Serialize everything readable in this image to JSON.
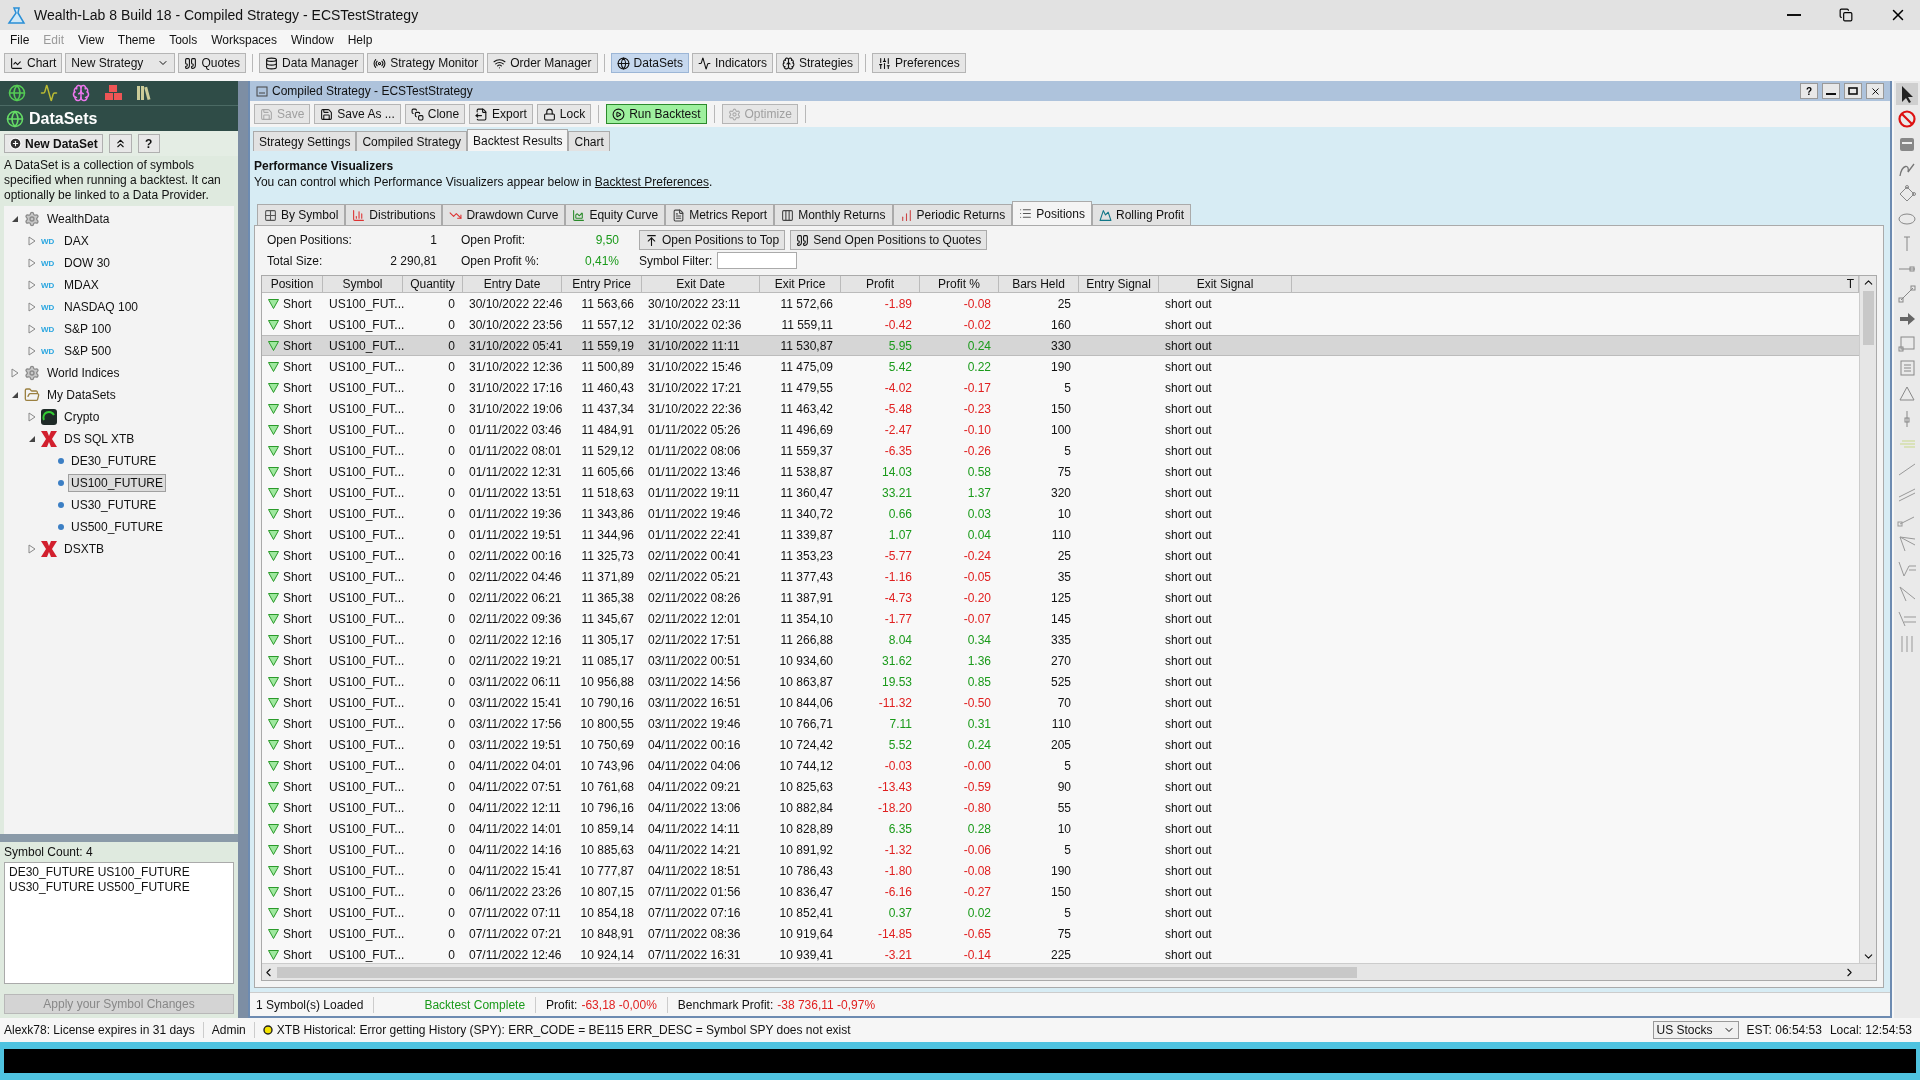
{
  "window": {
    "title": "Wealth-Lab 8 Build 18 - Compiled Strategy - ECSTestStrategy"
  },
  "menu": [
    {
      "label": "File",
      "disabled": false
    },
    {
      "label": "Edit",
      "disabled": true
    },
    {
      "label": "View",
      "disabled": false
    },
    {
      "label": "Theme",
      "disabled": false
    },
    {
      "label": "Tools",
      "disabled": false
    },
    {
      "label": "Workspaces",
      "disabled": false
    },
    {
      "label": "Window",
      "disabled": false
    },
    {
      "label": "Help",
      "disabled": false
    }
  ],
  "toolbar_groups": [
    [
      {
        "label": "Chart",
        "kind": "button",
        "selected": false
      },
      {
        "label": "New Strategy",
        "kind": "dropdown",
        "selected": false
      },
      {
        "label": "Quotes",
        "kind": "button",
        "selected": false
      }
    ],
    [
      {
        "label": "Data Manager",
        "kind": "button",
        "selected": false
      },
      {
        "label": "Strategy Monitor",
        "kind": "button",
        "selected": false
      },
      {
        "label": "Order Manager",
        "kind": "button",
        "selected": false
      }
    ],
    [
      {
        "label": "DataSets",
        "kind": "button",
        "selected": true
      },
      {
        "label": "Indicators",
        "kind": "button",
        "selected": false
      },
      {
        "label": "Strategies",
        "kind": "button",
        "selected": false
      }
    ],
    [
      {
        "label": "Preferences",
        "kind": "button",
        "selected": false
      }
    ]
  ],
  "sidebar": {
    "title": "DataSets",
    "buttons": [
      {
        "kind": "new",
        "label": "New DataSet"
      },
      {
        "kind": "collapse"
      },
      {
        "kind": "help",
        "label": "?"
      }
    ],
    "description": "A DataSet is a collection of symbols specified when running a backtest. It can optionally be linked to a Data Provider.",
    "tree": [
      {
        "label": "WealthData",
        "kind": "gear",
        "expanded": true,
        "selected": false,
        "children": [
          {
            "label": "DAX",
            "kind": "wd",
            "badge": "WD",
            "expanded": false,
            "selected": false
          },
          {
            "label": "DOW 30",
            "kind": "wd",
            "badge": "WD",
            "expanded": false,
            "selected": false
          },
          {
            "label": "MDAX",
            "kind": "wd",
            "badge": "WD",
            "expanded": false,
            "selected": false
          },
          {
            "label": "NASDAQ 100",
            "kind": "wd",
            "badge": "WD",
            "expanded": false,
            "selected": false
          },
          {
            "label": "S&P 100",
            "kind": "wd",
            "badge": "WD",
            "expanded": false,
            "selected": false
          },
          {
            "label": "S&P 500",
            "kind": "wd",
            "badge": "WD",
            "expanded": false,
            "selected": false
          }
        ]
      },
      {
        "label": "World Indices",
        "kind": "gear",
        "expanded": false,
        "selected": false
      },
      {
        "label": "My DataSets",
        "kind": "folder",
        "expanded": true,
        "selected": false,
        "children": [
          {
            "label": "Crypto",
            "kind": "crypto",
            "expanded": false,
            "selected": false
          },
          {
            "label": "DS SQL XTB",
            "kind": "xtb",
            "expanded": true,
            "selected": false,
            "children": [
              {
                "label": "DE30_FUTURE",
                "kind": "dot",
                "selected": false
              },
              {
                "label": "US100_FUTURE",
                "kind": "dot",
                "selected": true
              },
              {
                "label": "US30_FUTURE",
                "kind": "dot",
                "selected": false
              },
              {
                "label": "US500_FUTURE",
                "kind": "dot",
                "selected": false
              }
            ]
          },
          {
            "label": "DSXTB",
            "kind": "xtb",
            "expanded": false,
            "selected": false
          }
        ]
      }
    ],
    "symbol_count": "Symbol Count: 4",
    "symbols": [
      "DE30_FUTURE US100_FUTURE",
      "US30_FUTURE US500_FUTURE"
    ],
    "apply_button": {
      "label": "Apply your Symbol Changes",
      "disabled": true
    }
  },
  "document": {
    "title": "Compiled Strategy - ECSTestStrategy",
    "help": "?",
    "toolbar": [
      {
        "label": "Save",
        "disabled": true,
        "highlighted": false
      },
      {
        "label": "Save As ...",
        "disabled": false,
        "highlighted": false
      },
      {
        "label": "Clone",
        "disabled": false,
        "highlighted": false
      },
      {
        "label": "Export",
        "disabled": false,
        "highlighted": false
      },
      {
        "label": "Lock",
        "disabled": false,
        "highlighted": false
      },
      {
        "label": "Run Backtest",
        "disabled": false,
        "highlighted": true
      },
      {
        "label": "Optimize",
        "disabled": true,
        "highlighted": false
      }
    ],
    "tabs": [
      {
        "label": "Strategy Settings",
        "selected": false
      },
      {
        "label": "Compiled Strategy",
        "selected": false
      },
      {
        "label": "Backtest Results",
        "selected": true
      },
      {
        "label": "Chart",
        "selected": false
      }
    ],
    "heading": "Performance Visualizers",
    "note": "You can control which Performance Visualizers appear below in ",
    "link": "Backtest Preferences",
    "note_end": ".",
    "visualizer_tabs": [
      {
        "label": "By Symbol",
        "selected": false
      },
      {
        "label": "Distributions",
        "selected": false
      },
      {
        "label": "Drawdown Curve",
        "selected": false
      },
      {
        "label": "Equity Curve",
        "selected": false
      },
      {
        "label": "Metrics Report",
        "selected": false
      },
      {
        "label": "Monthly Returns",
        "selected": false
      },
      {
        "label": "Periodic Returns",
        "selected": false
      },
      {
        "label": "Positions",
        "selected": true
      },
      {
        "label": "Rolling Profit",
        "selected": false
      }
    ],
    "stats": [
      {
        "label": "Open Positions:",
        "value": "1",
        "gain": false
      },
      {
        "label": "Open Profit:",
        "value": "9,50",
        "gain": true
      },
      {
        "label": "Total Size:",
        "value": "2 290,81",
        "gain": false
      },
      {
        "label": "Open Profit %:",
        "value": "0,41%",
        "gain": true
      }
    ],
    "position_buttons": [
      "Open Positions to Top",
      "Send Open Positions to Quotes"
    ],
    "symbol_filter": {
      "label": "Symbol Filter:"
    },
    "table": {
      "columns": [
        "Position",
        "Symbol",
        "Quantity",
        "Entry Date",
        "Entry Price",
        "Exit Date",
        "Exit Price",
        "Profit",
        "Profit %",
        "Bars Held",
        "Entry Signal",
        "Exit Signal",
        "T"
      ],
      "rows": [
        {
          "position": "Short",
          "symbol": "US100_FUT...",
          "quantity": "0",
          "entry_date": "30/10/2022 22:46",
          "entry_price": "11 563,66",
          "exit_date": "30/10/2022 23:11",
          "exit_price": "11 572,66",
          "profit": "-1.89",
          "profit_pct": "-0.08",
          "bars_held": "25",
          "exit_signal": "short out",
          "gain": false,
          "selected": false
        },
        {
          "position": "Short",
          "symbol": "US100_FUT...",
          "quantity": "0",
          "entry_date": "30/10/2022 23:56",
          "entry_price": "11 557,12",
          "exit_date": "31/10/2022 02:36",
          "exit_price": "11 559,11",
          "profit": "-0.42",
          "profit_pct": "-0.02",
          "bars_held": "160",
          "exit_signal": "short out",
          "gain": false,
          "selected": false
        },
        {
          "position": "Short",
          "symbol": "US100_FUT...",
          "quantity": "0",
          "entry_date": "31/10/2022 05:41",
          "entry_price": "11 559,19",
          "exit_date": "31/10/2022 11:11",
          "exit_price": "11 530,87",
          "profit": "5.95",
          "profit_pct": "0.24",
          "bars_held": "330",
          "exit_signal": "short out",
          "gain": true,
          "selected": true
        },
        {
          "position": "Short",
          "symbol": "US100_FUT...",
          "quantity": "0",
          "entry_date": "31/10/2022 12:36",
          "entry_price": "11 500,89",
          "exit_date": "31/10/2022 15:46",
          "exit_price": "11 475,09",
          "profit": "5.42",
          "profit_pct": "0.22",
          "bars_held": "190",
          "exit_signal": "short out",
          "gain": true,
          "selected": false
        },
        {
          "position": "Short",
          "symbol": "US100_FUT...",
          "quantity": "0",
          "entry_date": "31/10/2022 17:16",
          "entry_price": "11 460,43",
          "exit_date": "31/10/2022 17:21",
          "exit_price": "11 479,55",
          "profit": "-4.02",
          "profit_pct": "-0.17",
          "bars_held": "5",
          "exit_signal": "short out",
          "gain": false,
          "selected": false
        },
        {
          "position": "Short",
          "symbol": "US100_FUT...",
          "quantity": "0",
          "entry_date": "31/10/2022 19:06",
          "entry_price": "11 437,34",
          "exit_date": "31/10/2022 22:36",
          "exit_price": "11 463,42",
          "profit": "-5.48",
          "profit_pct": "-0.23",
          "bars_held": "150",
          "exit_signal": "short out",
          "gain": false,
          "selected": false
        },
        {
          "position": "Short",
          "symbol": "US100_FUT...",
          "quantity": "0",
          "entry_date": "01/11/2022 03:46",
          "entry_price": "11 484,91",
          "exit_date": "01/11/2022 05:26",
          "exit_price": "11 496,69",
          "profit": "-2.47",
          "profit_pct": "-0.10",
          "bars_held": "100",
          "exit_signal": "short out",
          "gain": false,
          "selected": false
        },
        {
          "position": "Short",
          "symbol": "US100_FUT...",
          "quantity": "0",
          "entry_date": "01/11/2022 08:01",
          "entry_price": "11 529,12",
          "exit_date": "01/11/2022 08:06",
          "exit_price": "11 559,37",
          "profit": "-6.35",
          "profit_pct": "-0.26",
          "bars_held": "5",
          "exit_signal": "short out",
          "gain": false,
          "selected": false
        },
        {
          "position": "Short",
          "symbol": "US100_FUT...",
          "quantity": "0",
          "entry_date": "01/11/2022 12:31",
          "entry_price": "11 605,66",
          "exit_date": "01/11/2022 13:46",
          "exit_price": "11 538,87",
          "profit": "14.03",
          "profit_pct": "0.58",
          "bars_held": "75",
          "exit_signal": "short out",
          "gain": true,
          "selected": false
        },
        {
          "position": "Short",
          "symbol": "US100_FUT...",
          "quantity": "0",
          "entry_date": "01/11/2022 13:51",
          "entry_price": "11 518,63",
          "exit_date": "01/11/2022 19:11",
          "exit_price": "11 360,47",
          "profit": "33.21",
          "profit_pct": "1.37",
          "bars_held": "320",
          "exit_signal": "short out",
          "gain": true,
          "selected": false
        },
        {
          "position": "Short",
          "symbol": "US100_FUT...",
          "quantity": "0",
          "entry_date": "01/11/2022 19:36",
          "entry_price": "11 343,86",
          "exit_date": "01/11/2022 19:46",
          "exit_price": "11 340,72",
          "profit": "0.66",
          "profit_pct": "0.03",
          "bars_held": "10",
          "exit_signal": "short out",
          "gain": true,
          "selected": false
        },
        {
          "position": "Short",
          "symbol": "US100_FUT...",
          "quantity": "0",
          "entry_date": "01/11/2022 19:51",
          "entry_price": "11 344,96",
          "exit_date": "01/11/2022 22:41",
          "exit_price": "11 339,87",
          "profit": "1.07",
          "profit_pct": "0.04",
          "bars_held": "110",
          "exit_signal": "short out",
          "gain": true,
          "selected": false
        },
        {
          "position": "Short",
          "symbol": "US100_FUT...",
          "quantity": "0",
          "entry_date": "02/11/2022 00:16",
          "entry_price": "11 325,73",
          "exit_date": "02/11/2022 00:41",
          "exit_price": "11 353,23",
          "profit": "-5.77",
          "profit_pct": "-0.24",
          "bars_held": "25",
          "exit_signal": "short out",
          "gain": false,
          "selected": false
        },
        {
          "position": "Short",
          "symbol": "US100_FUT...",
          "quantity": "0",
          "entry_date": "02/11/2022 04:46",
          "entry_price": "11 371,89",
          "exit_date": "02/11/2022 05:21",
          "exit_price": "11 377,43",
          "profit": "-1.16",
          "profit_pct": "-0.05",
          "bars_held": "35",
          "exit_signal": "short out",
          "gain": false,
          "selected": false
        },
        {
          "position": "Short",
          "symbol": "US100_FUT...",
          "quantity": "0",
          "entry_date": "02/11/2022 06:21",
          "entry_price": "11 365,38",
          "exit_date": "02/11/2022 08:26",
          "exit_price": "11 387,91",
          "profit": "-4.73",
          "profit_pct": "-0.20",
          "bars_held": "125",
          "exit_signal": "short out",
          "gain": false,
          "selected": false
        },
        {
          "position": "Short",
          "symbol": "US100_FUT...",
          "quantity": "0",
          "entry_date": "02/11/2022 09:36",
          "entry_price": "11 345,67",
          "exit_date": "02/11/2022 12:01",
          "exit_price": "11 354,10",
          "profit": "-1.77",
          "profit_pct": "-0.07",
          "bars_held": "145",
          "exit_signal": "short out",
          "gain": false,
          "selected": false
        },
        {
          "position": "Short",
          "symbol": "US100_FUT...",
          "quantity": "0",
          "entry_date": "02/11/2022 12:16",
          "entry_price": "11 305,17",
          "exit_date": "02/11/2022 17:51",
          "exit_price": "11 266,88",
          "profit": "8.04",
          "profit_pct": "0.34",
          "bars_held": "335",
          "exit_signal": "short out",
          "gain": true,
          "selected": false
        },
        {
          "position": "Short",
          "symbol": "US100_FUT...",
          "quantity": "0",
          "entry_date": "02/11/2022 19:21",
          "entry_price": "11 085,17",
          "exit_date": "03/11/2022 00:51",
          "exit_price": "10 934,60",
          "profit": "31.62",
          "profit_pct": "1.36",
          "bars_held": "270",
          "exit_signal": "short out",
          "gain": true,
          "selected": false
        },
        {
          "position": "Short",
          "symbol": "US100_FUT...",
          "quantity": "0",
          "entry_date": "03/11/2022 06:11",
          "entry_price": "10 956,88",
          "exit_date": "03/11/2022 14:56",
          "exit_price": "10 863,87",
          "profit": "19.53",
          "profit_pct": "0.85",
          "bars_held": "525",
          "exit_signal": "short out",
          "gain": true,
          "selected": false
        },
        {
          "position": "Short",
          "symbol": "US100_FUT...",
          "quantity": "0",
          "entry_date": "03/11/2022 15:41",
          "entry_price": "10 790,16",
          "exit_date": "03/11/2022 16:51",
          "exit_price": "10 844,06",
          "profit": "-11.32",
          "profit_pct": "-0.50",
          "bars_held": "70",
          "exit_signal": "short out",
          "gain": false,
          "selected": false
        },
        {
          "position": "Short",
          "symbol": "US100_FUT...",
          "quantity": "0",
          "entry_date": "03/11/2022 17:56",
          "entry_price": "10 800,55",
          "exit_date": "03/11/2022 19:46",
          "exit_price": "10 766,71",
          "profit": "7.11",
          "profit_pct": "0.31",
          "bars_held": "110",
          "exit_signal": "short out",
          "gain": true,
          "selected": false
        },
        {
          "position": "Short",
          "symbol": "US100_FUT...",
          "quantity": "0",
          "entry_date": "03/11/2022 19:51",
          "entry_price": "10 750,69",
          "exit_date": "04/11/2022 00:16",
          "exit_price": "10 724,42",
          "profit": "5.52",
          "profit_pct": "0.24",
          "bars_held": "205",
          "exit_signal": "short out",
          "gain": true,
          "selected": false
        },
        {
          "position": "Short",
          "symbol": "US100_FUT...",
          "quantity": "0",
          "entry_date": "04/11/2022 04:01",
          "entry_price": "10 743,96",
          "exit_date": "04/11/2022 04:06",
          "exit_price": "10 744,12",
          "profit": "-0.03",
          "profit_pct": "-0.00",
          "bars_held": "5",
          "exit_signal": "short out",
          "gain": false,
          "selected": false
        },
        {
          "position": "Short",
          "symbol": "US100_FUT...",
          "quantity": "0",
          "entry_date": "04/11/2022 07:51",
          "entry_price": "10 761,68",
          "exit_date": "04/11/2022 09:21",
          "exit_price": "10 825,63",
          "profit": "-13.43",
          "profit_pct": "-0.59",
          "bars_held": "90",
          "exit_signal": "short out",
          "gain": false,
          "selected": false
        },
        {
          "position": "Short",
          "symbol": "US100_FUT...",
          "quantity": "0",
          "entry_date": "04/11/2022 12:11",
          "entry_price": "10 796,16",
          "exit_date": "04/11/2022 13:06",
          "exit_price": "10 882,84",
          "profit": "-18.20",
          "profit_pct": "-0.80",
          "bars_held": "55",
          "exit_signal": "short out",
          "gain": false,
          "selected": false
        },
        {
          "position": "Short",
          "symbol": "US100_FUT...",
          "quantity": "0",
          "entry_date": "04/11/2022 14:01",
          "entry_price": "10 859,14",
          "exit_date": "04/11/2022 14:11",
          "exit_price": "10 828,89",
          "profit": "6.35",
          "profit_pct": "0.28",
          "bars_held": "10",
          "exit_signal": "short out",
          "gain": true,
          "selected": false
        },
        {
          "position": "Short",
          "symbol": "US100_FUT...",
          "quantity": "0",
          "entry_date": "04/11/2022 14:16",
          "entry_price": "10 885,63",
          "exit_date": "04/11/2022 14:21",
          "exit_price": "10 891,92",
          "profit": "-1.32",
          "profit_pct": "-0.06",
          "bars_held": "5",
          "exit_signal": "short out",
          "gain": false,
          "selected": false
        },
        {
          "position": "Short",
          "symbol": "US100_FUT...",
          "quantity": "0",
          "entry_date": "04/11/2022 15:41",
          "entry_price": "10 777,87",
          "exit_date": "04/11/2022 18:51",
          "exit_price": "10 786,43",
          "profit": "-1.80",
          "profit_pct": "-0.08",
          "bars_held": "190",
          "exit_signal": "short out",
          "gain": false,
          "selected": false
        },
        {
          "position": "Short",
          "symbol": "US100_FUT...",
          "quantity": "0",
          "entry_date": "06/11/2022 23:26",
          "entry_price": "10 807,15",
          "exit_date": "07/11/2022 01:56",
          "exit_price": "10 836,47",
          "profit": "-6.16",
          "profit_pct": "-0.27",
          "bars_held": "150",
          "exit_signal": "short out",
          "gain": false,
          "selected": false
        },
        {
          "position": "Short",
          "symbol": "US100_FUT...",
          "quantity": "0",
          "entry_date": "07/11/2022 07:11",
          "entry_price": "10 854,18",
          "exit_date": "07/11/2022 07:16",
          "exit_price": "10 852,41",
          "profit": "0.37",
          "profit_pct": "0.02",
          "bars_held": "5",
          "exit_signal": "short out",
          "gain": true,
          "selected": false
        },
        {
          "position": "Short",
          "symbol": "US100_FUT...",
          "quantity": "0",
          "entry_date": "07/11/2022 07:21",
          "entry_price": "10 848,91",
          "exit_date": "07/11/2022 08:36",
          "exit_price": "10 919,64",
          "profit": "-14.85",
          "profit_pct": "-0.65",
          "bars_held": "75",
          "exit_signal": "short out",
          "gain": false,
          "selected": false
        },
        {
          "position": "Short",
          "symbol": "US100_FUT...",
          "quantity": "0",
          "entry_date": "07/11/2022 12:46",
          "entry_price": "10 924,14",
          "exit_date": "07/11/2022 16:31",
          "exit_price": "10 939,41",
          "profit": "-3.21",
          "profit_pct": "-0.14",
          "bars_held": "225",
          "exit_signal": "short out",
          "gain": false,
          "selected": false
        }
      ]
    },
    "status": {
      "loaded": "1 Symbol(s) Loaded",
      "state": "Backtest Complete",
      "profit_label": "Profit:",
      "profit": "-63,18 -0,00%",
      "benchmark_label": "Benchmark Profit:",
      "benchmark": "-38 736,11 -0,97%"
    }
  },
  "drawing_tools": [
    {
      "kind": "pointer",
      "selected": true
    },
    {
      "kind": "erase",
      "selected": false
    },
    {
      "kind": "calendar",
      "selected": false
    },
    {
      "kind": "curve",
      "selected": false
    },
    {
      "kind": "diamond",
      "selected": false
    },
    {
      "kind": "ellipse",
      "selected": false
    },
    {
      "kind": "vertical",
      "selected": false
    },
    {
      "kind": "horizontal",
      "selected": false
    },
    {
      "kind": "segment",
      "selected": false
    },
    {
      "kind": "arrow",
      "selected": false
    },
    {
      "kind": "rectangle",
      "selected": false
    },
    {
      "kind": "note",
      "selected": false
    },
    {
      "kind": "triangle",
      "selected": false
    },
    {
      "kind": "marker",
      "selected": false
    },
    {
      "kind": "levels",
      "selected": false
    },
    {
      "kind": "line",
      "selected": false
    },
    {
      "kind": "channel",
      "selected": false
    },
    {
      "kind": "ray",
      "selected": false
    },
    {
      "kind": "fan",
      "selected": false
    },
    {
      "kind": "pitchfork",
      "selected": false
    },
    {
      "kind": "speed",
      "selected": false
    },
    {
      "kind": "gann",
      "selected": false
    },
    {
      "kind": "cycles",
      "selected": false
    }
  ],
  "status_bar": {
    "license": "Alexk78: License expires in 31 days",
    "user": "Admin",
    "message": "XTB Historical: Error getting History (SPY): ERR_CODE = BE115 ERR_DESC = Symbol SPY does not exist",
    "market": "US Stocks",
    "est": "EST: 06:54:53",
    "local": "Local: 12:54:53"
  }
}
